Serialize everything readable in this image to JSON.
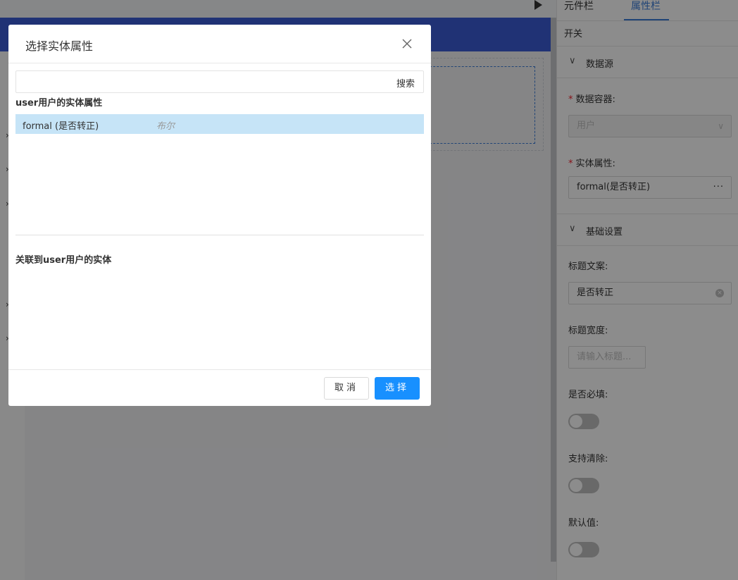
{
  "panel": {
    "tabs": [
      {
        "label": "元件栏",
        "active": false
      },
      {
        "label": "属性栏",
        "active": true
      }
    ],
    "component_type": "开关",
    "sections": {
      "datasource": {
        "title": "数据源",
        "container_label": "数据容器:",
        "container_value": "用户",
        "attr_label": "实体属性:",
        "attr_value": "formal(是否转正)",
        "attr_more": "···"
      },
      "basic": {
        "title": "基础设置",
        "title_text_label": "标题文案:",
        "title_text_value": "是否转正",
        "title_width_label": "标题宽度:",
        "title_width_placeholder": "请输入标题...",
        "required_label": "是否必填:",
        "required_on": false,
        "clearable_label": "支持清除:",
        "clearable_on": false,
        "default_label": "默认值:",
        "default_on": false
      }
    },
    "required_mark": "*"
  },
  "modal": {
    "title": "选择实体属性",
    "search_placeholder": "",
    "search_button": "搜索",
    "entity_attr_title": "user用户的实体属性",
    "attributes": [
      {
        "name": "formal (是否转正)",
        "type": "布尔",
        "selected": true
      }
    ],
    "related_title": "关联到user用户的实体",
    "cancel_label": "取消",
    "select_label": "选择"
  },
  "colors": {
    "primary": "#1890ff",
    "header_blue": "#3b5bd6",
    "selected_row": "#c6e4f7",
    "tab_active": "#3b7dd8"
  }
}
